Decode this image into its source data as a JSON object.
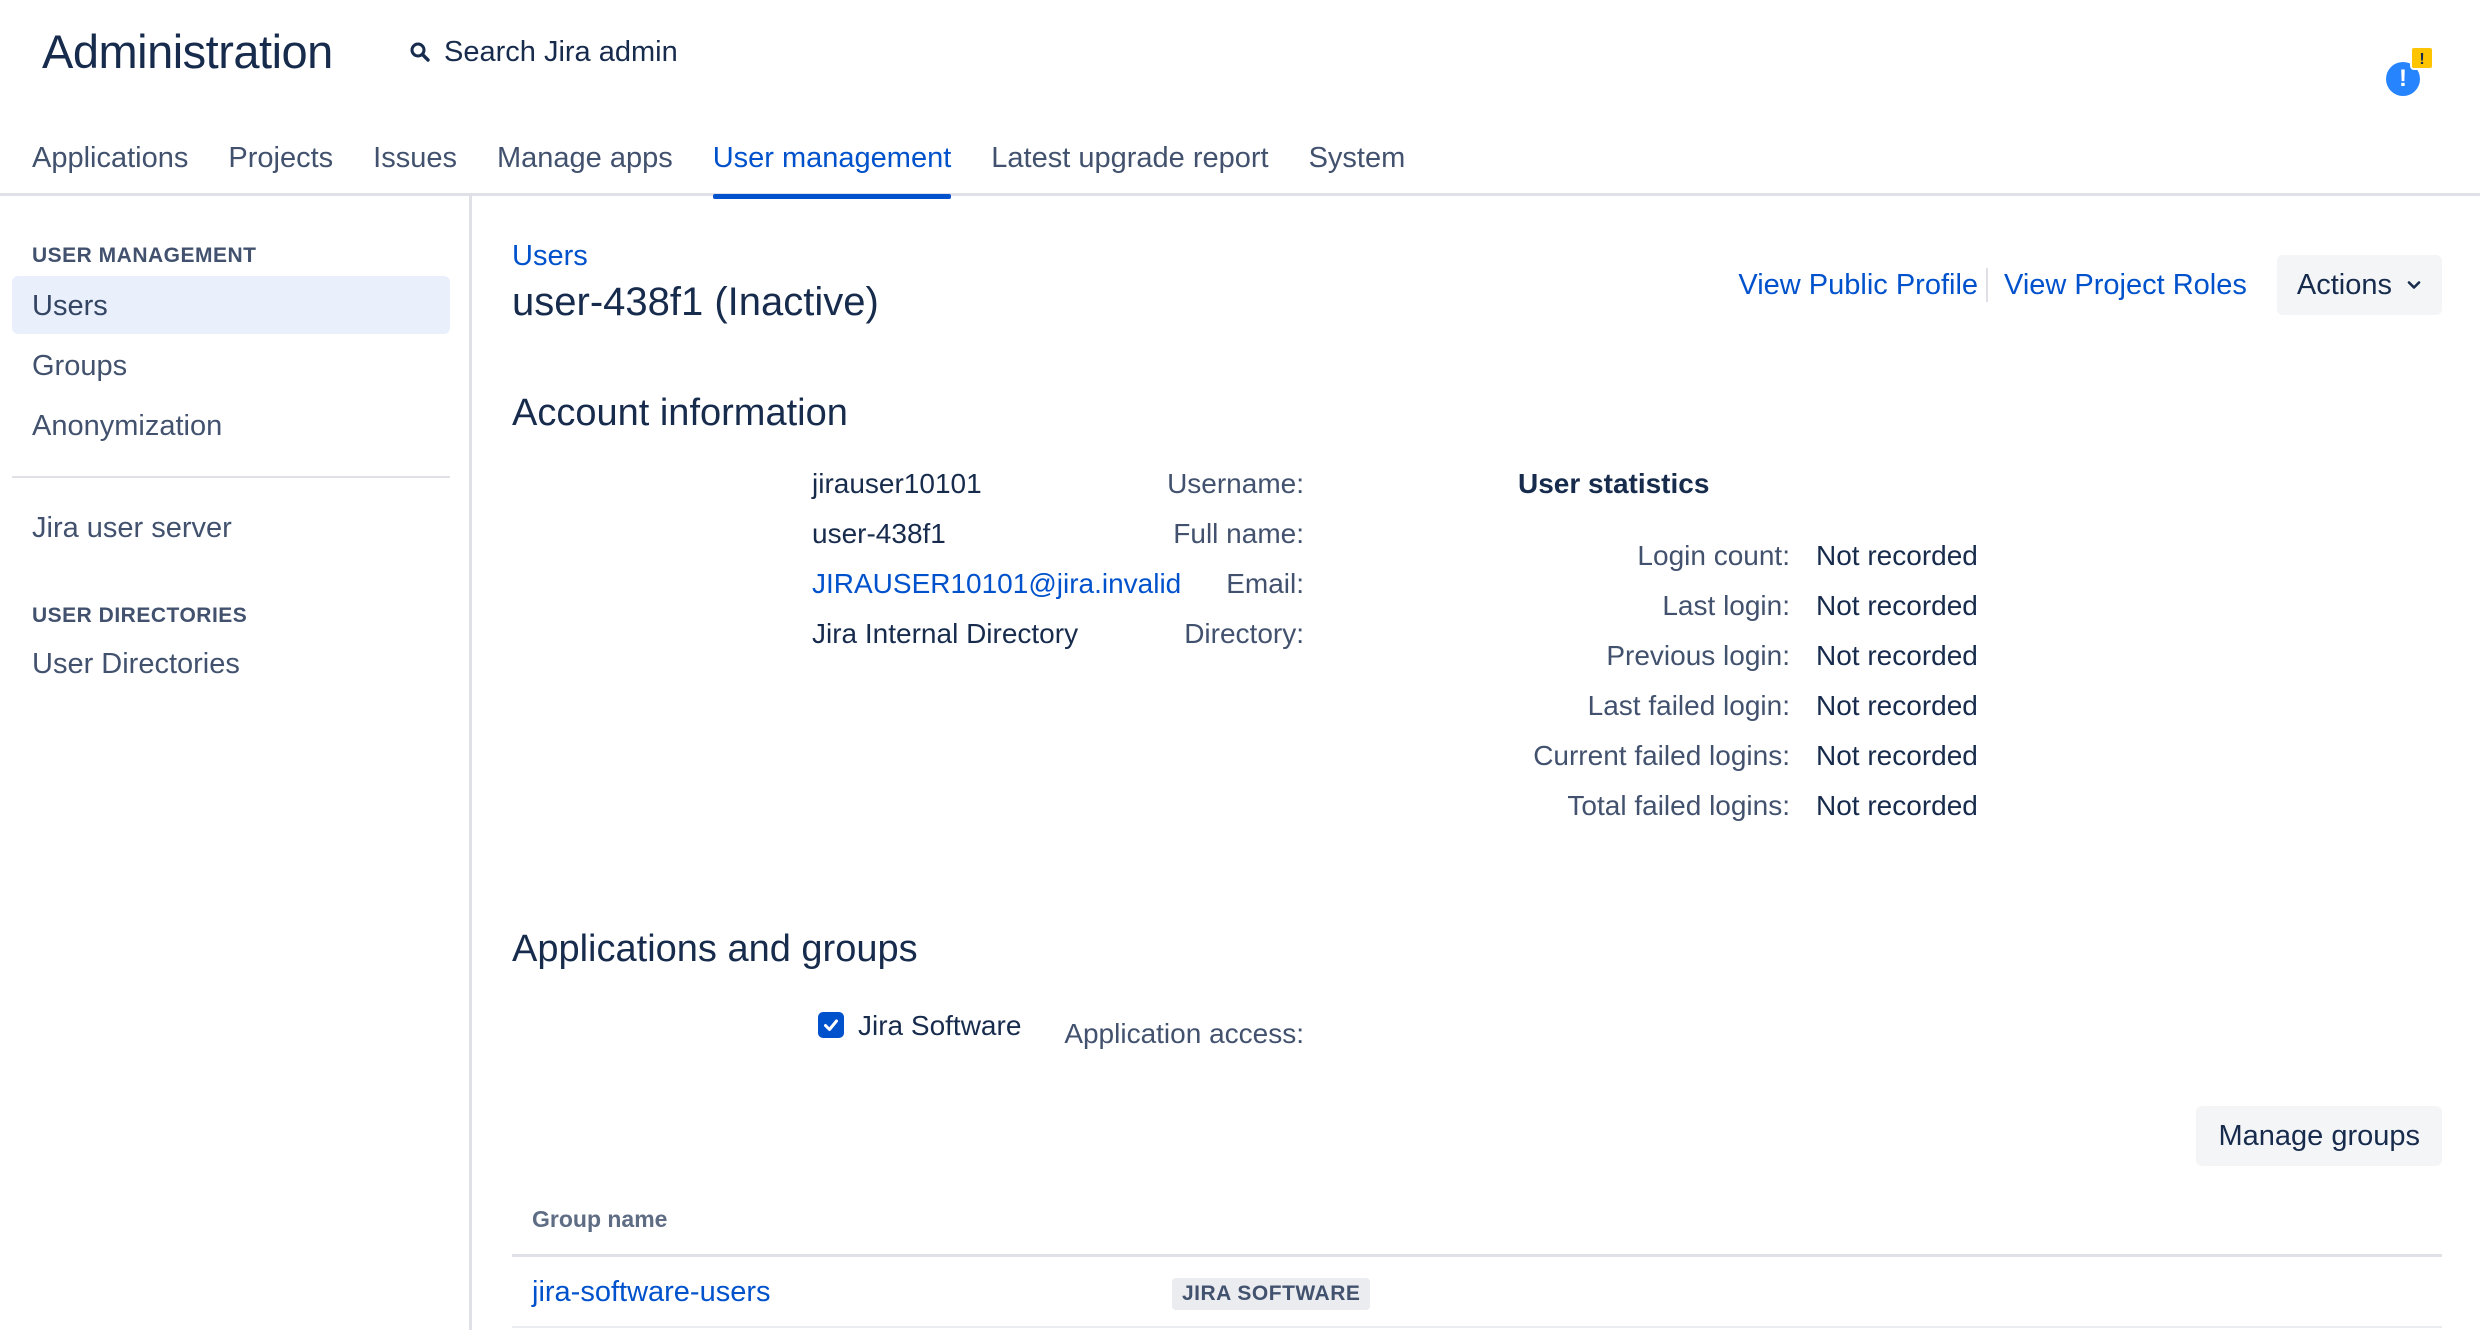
{
  "header": {
    "title": "Administration",
    "search_label": "Search Jira admin",
    "notification_badge": "!"
  },
  "nav": {
    "tabs": [
      {
        "label": "Applications",
        "active": false
      },
      {
        "label": "Projects",
        "active": false
      },
      {
        "label": "Issues",
        "active": false
      },
      {
        "label": "Manage apps",
        "active": false
      },
      {
        "label": "User management",
        "active": true
      },
      {
        "label": "Latest upgrade report",
        "active": false
      },
      {
        "label": "System",
        "active": false
      }
    ]
  },
  "sidebar": {
    "section1_heading": "USER MANAGEMENT",
    "items": [
      {
        "label": "Users",
        "selected": true
      },
      {
        "label": "Groups",
        "selected": false
      },
      {
        "label": "Anonymization",
        "selected": false
      }
    ],
    "server_item": "Jira user server",
    "section2_heading": "USER DIRECTORIES",
    "directories_item": "User Directories"
  },
  "main": {
    "breadcrumb": "Users",
    "title": "user-438f1 (Inactive)",
    "view_public_profile": "View Public Profile",
    "view_project_roles": "View Project Roles",
    "actions_label": "Actions"
  },
  "account": {
    "heading": "Account information",
    "fields": [
      {
        "label": "Username:",
        "value": "jirauser10101"
      },
      {
        "label": "Full name:",
        "value": "user-438f1"
      },
      {
        "label": "Email:",
        "value": "JIRAUSER10101@jira.invalid"
      },
      {
        "label": "Directory:",
        "value": "Jira Internal Directory"
      }
    ]
  },
  "stats": {
    "heading": "User statistics",
    "fields": [
      {
        "label": "Login count:",
        "value": "Not recorded"
      },
      {
        "label": "Last login:",
        "value": "Not recorded"
      },
      {
        "label": "Previous login:",
        "value": "Not recorded"
      },
      {
        "label": "Last failed login:",
        "value": "Not recorded"
      },
      {
        "label": "Current failed logins:",
        "value": "Not recorded"
      },
      {
        "label": "Total failed logins:",
        "value": "Not recorded"
      }
    ]
  },
  "apps": {
    "heading": "Applications and groups",
    "access_label": "Application access:",
    "access_app": "Jira Software",
    "access_checked": true,
    "manage_groups_label": "Manage groups",
    "table_header": "Group name",
    "groups": [
      {
        "name": "jira-software-users",
        "application": "JIRA SOFTWARE"
      }
    ]
  },
  "colors": {
    "link": "#0052cc",
    "text": "#172b4d",
    "subtle": "#42526e",
    "selected_bg": "#e9f0fb"
  }
}
